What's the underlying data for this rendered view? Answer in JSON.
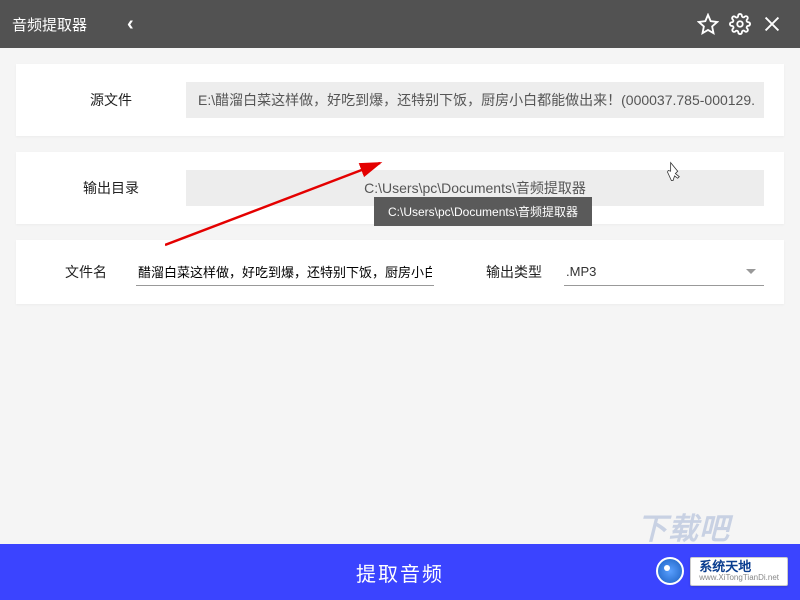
{
  "header": {
    "title": "音频提取器"
  },
  "source": {
    "label": "源文件",
    "value": "E:\\醋溜白菜这样做，好吃到爆，还特别下饭，厨房小白都能做出来！(000037.785-000129."
  },
  "output_dir": {
    "label": "输出目录",
    "value": "C:\\Users\\pc\\Documents\\音频提取器"
  },
  "filename": {
    "label": "文件名",
    "value": "醋溜白菜这样做，好吃到爆，还特别下饭，厨房小白"
  },
  "output_type": {
    "label": "输出类型",
    "value": ".MP3"
  },
  "tooltip": "C:\\Users\\pc\\Documents\\音频提取器",
  "extract_btn": "提取音频",
  "watermark": {
    "name": "系统天地",
    "url": "www.XiTongTianDi.net"
  }
}
